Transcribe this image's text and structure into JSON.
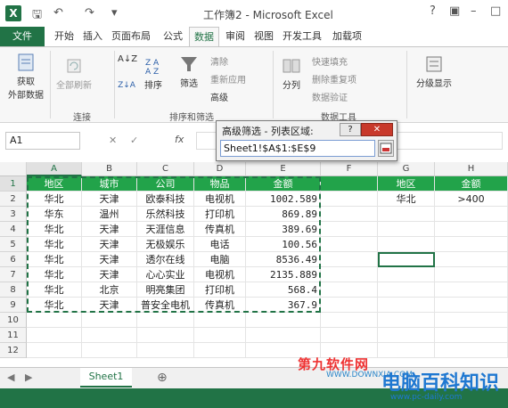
{
  "window": {
    "title": "工作簿2 - Microsoft Excel",
    "app_icon": "X"
  },
  "tabs": [
    "文件",
    "开始",
    "插入",
    "页面布局",
    "公式",
    "数据",
    "审阅",
    "视图",
    "开发工具",
    "加载项"
  ],
  "active_tab": "数据",
  "ribbon": {
    "get_external": "获取\n外部数据",
    "refresh_all": "全部刷新",
    "sort": "排序",
    "filter": "筛选",
    "clear": "清除",
    "reapply": "重新应用",
    "advanced": "高级",
    "text_to_columns": "分列",
    "flash_fill": "快速填充",
    "remove_dup": "删除重复项",
    "validation": "数据验证",
    "outline": "分级显示",
    "group_connections": "连接",
    "group_sort_filter": "排序和筛选",
    "group_data_tools": "数据工具"
  },
  "formula_bar": {
    "name_box": "A1",
    "fx": "fx"
  },
  "dialog": {
    "title": "高级筛选 - 列表区域:",
    "help": "?",
    "close": "✕",
    "value": "Sheet1!$A$1:$E$9"
  },
  "columns": [
    "A",
    "B",
    "C",
    "D",
    "E",
    "F",
    "G",
    "H"
  ],
  "rows": [
    "1",
    "2",
    "3",
    "4",
    "5",
    "6",
    "7",
    "8",
    "9",
    "10",
    "11",
    "12"
  ],
  "table_header": [
    "地区",
    "城市",
    "公司",
    "物品",
    "金额"
  ],
  "table_rows": [
    [
      "华北",
      "天津",
      "欧泰科技",
      "电视机",
      "1002.589"
    ],
    [
      "华东",
      "温州",
      "乐然科技",
      "打印机",
      "869.89"
    ],
    [
      "华北",
      "天津",
      "天涯信息",
      "传真机",
      "389.69"
    ],
    [
      "华北",
      "天津",
      "无极娱乐",
      "电话",
      "100.56"
    ],
    [
      "华北",
      "天津",
      "透尔在线",
      "电脑",
      "8536.49"
    ],
    [
      "华北",
      "天津",
      "心心实业",
      "电视机",
      "2135.889"
    ],
    [
      "华北",
      "北京",
      "明亮集团",
      "打印机",
      "568.4"
    ],
    [
      "华北",
      "天津",
      "普安全电机",
      "传真机",
      "367.9"
    ]
  ],
  "criteria": {
    "header": [
      "地区",
      "金额"
    ],
    "values": [
      "华北",
      ">400"
    ]
  },
  "sheet_tab": "Sheet1",
  "add_sheet": "⊕",
  "watermark": {
    "text1": "第九软件网",
    "text2": "WWW.DOWNXIA.COM",
    "logo": "电脑百科知识",
    "url": "www.pc-daily.com"
  },
  "colors": {
    "excel_green": "#217346",
    "header_green": "#22a34a"
  }
}
